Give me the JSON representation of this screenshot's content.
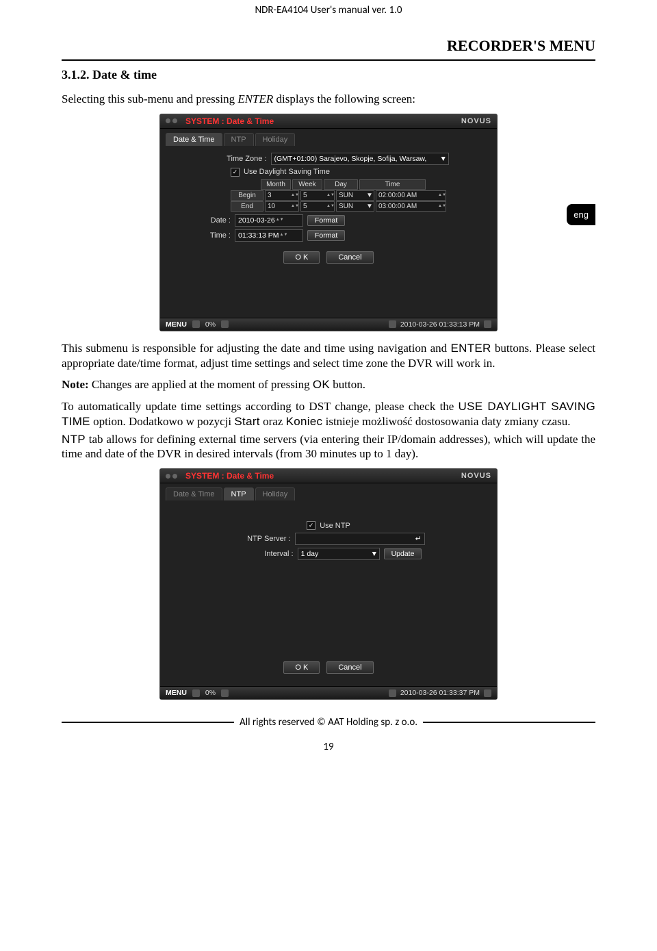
{
  "doc": {
    "header": "NDR-EA4104 User's manual ver. 1.0",
    "section_title": "RECORDER'S MENU",
    "subsection": "3.1.2. Date & time",
    "intro": "Selecting this sub-menu and pressing ENTER displays the following screen:",
    "lang_tab": "eng",
    "p1_a": "This submenu is responsible for adjusting the date and time using navigation and ",
    "p1_enter": "ENTER",
    "p1_b": " buttons. Please select appropriate date/time format, adjust time settings and select time zone the DVR will work in.",
    "note_label": "Note:",
    "note_text": " Changes are applied at the moment of pressing ",
    "note_ok": "OK",
    "note_tail": " button.",
    "p2_a": "To automatically update time settings according to DST change, please check the ",
    "p2_dst": "USE DAYLIGHT SAVING TIME",
    "p2_b": " option. Dodatkowo w pozycji ",
    "p2_start": "Start",
    "p2_c": " oraz ",
    "p2_koniec": "Koniec",
    "p2_d": " istnieje możliwość dostosowania daty zmiany czasu.",
    "p3_a_pre": "",
    "p3_ntp": "NTP",
    "p3_a": " tab allows for defining external time servers (via entering their IP/domain addresses), which will update the time and date of the DVR in desired intervals (from 30 minutes up to 1 day).",
    "footer": "All rights reserved © AAT Holding sp. z o.o.",
    "page_num": "19"
  },
  "dvr1": {
    "title": "SYSTEM : Date & Time",
    "brand": "NOVUS",
    "tabs": [
      "Date & Time",
      "NTP",
      "Holiday"
    ],
    "active_tab": 0,
    "tz_label": "Time Zone :",
    "tz_value": "(GMT+01:00) Sarajevo, Skopje, Sofija, Warsaw,",
    "dst_checkbox": "Use Daylight Saving Time",
    "dst_headers": [
      "Month",
      "Week",
      "Day",
      "Time"
    ],
    "dst_rows": [
      {
        "label": "Begin",
        "month": "3",
        "week": "5",
        "day": "SUN",
        "time": "02:00:00 AM"
      },
      {
        "label": "End",
        "month": "10",
        "week": "5",
        "day": "SUN",
        "time": "03:00:00 AM"
      }
    ],
    "date_label": "Date :",
    "date_value": "2010-03-26",
    "time_label": "Time :",
    "time_value": "01:33:13 PM",
    "format_btn": "Format",
    "ok_btn": "O K",
    "cancel_btn": "Cancel",
    "status_menu": "MENU",
    "status_pct": "0%",
    "status_ts": "2010-03-26 01:33:13 PM"
  },
  "dvr2": {
    "title": "SYSTEM : Date & Time",
    "brand": "NOVUS",
    "tabs": [
      "Date & Time",
      "NTP",
      "Holiday"
    ],
    "active_tab": 1,
    "use_ntp": "Use NTP",
    "server_label": "NTP Server :",
    "server_value": "",
    "interval_label": "Interval :",
    "interval_value": "1 day",
    "update_btn": "Update",
    "ok_btn": "O K",
    "cancel_btn": "Cancel",
    "status_menu": "MENU",
    "status_pct": "0%",
    "status_ts": "2010-03-26 01:33:37 PM"
  }
}
